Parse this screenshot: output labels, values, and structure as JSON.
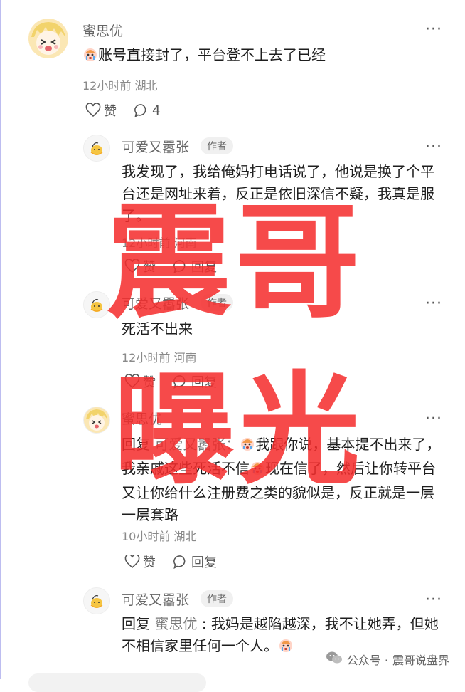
{
  "comments": [
    {
      "user": "蜜思优",
      "text": "账号直接封了，平台登不上去了已经",
      "time": "12小时前",
      "region": "湖北",
      "like_label": "赞",
      "reply_count": "4"
    },
    {
      "user": "可爱又嚣张",
      "author_tag": "作者",
      "text": "我发现了，我给俺妈打电话说了，他说是换了个平台还是网址来着，反正是依旧深信不疑，我真是服了。",
      "time": "12小时前",
      "region": "河南",
      "like_label": "赞",
      "reply_label": "回复"
    },
    {
      "user": "可爱又嚣张",
      "author_tag": "作者",
      "text": "死活不出来",
      "time": "12小时前",
      "region": "河南",
      "like_label": "赞",
      "reply_label": "回复"
    },
    {
      "user": "蜜思优",
      "reply_prefix": "回复",
      "reply_to": "可爱又嚣张",
      "text_a": "：",
      "text_b": "我跟你说，基本提不出来了，我亲戚这些死活不信",
      "text_c": "现在信了，然后让你转平台又让你给什么注册费之类的貌似是，反正就是一层一层套路",
      "time": "10小时前",
      "region": "湖北",
      "like_label": "赞",
      "reply_label": "回复"
    },
    {
      "user": "可爱又嚣张",
      "author_tag": "作者",
      "reply_prefix": "回复",
      "reply_to": "蜜思优",
      "text_a": " : ",
      "text_b": "我妈是越陷越深，我不让她弄，但她不相信家里任何一个人。"
    }
  ],
  "more_label": "···",
  "watermark": {
    "line1": "震哥",
    "line2": "曝光"
  },
  "footer": {
    "prefix": "公众号 · ",
    "name": "震哥说盘界"
  },
  "icons": [
    "like-icon",
    "comment-icon",
    "crying-emoji-icon",
    "wechat-icon"
  ]
}
